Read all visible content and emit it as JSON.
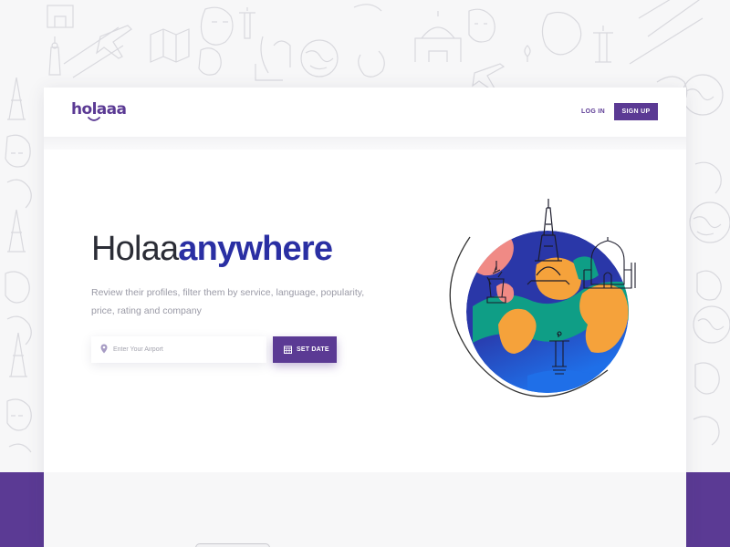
{
  "brand": {
    "logo_text": "holaaa",
    "primary_color": "#5b3a94",
    "accent_color": "#2a2fa3"
  },
  "nav": {
    "login_label": "LOG IN",
    "signup_label": "SIGN UP"
  },
  "hero": {
    "title_part1": "Holaa",
    "title_part2": "anywhere",
    "description": "Review their profiles, filter them by service, language, popularity, price, rating and company"
  },
  "search": {
    "placeholder": "Enter Your Airport",
    "value": "",
    "pin_icon": "location-pin-icon"
  },
  "set_date": {
    "label": "SET DATE",
    "icon": "calendar-icon"
  },
  "illustration": {
    "name": "globe-with-landmarks",
    "landmarks": [
      "statue-of-liberty",
      "eiffel-tower",
      "taj-mahal",
      "christ-the-redeemer"
    ],
    "colors": {
      "ocean": "#2a37a8",
      "ocean_light": "#1f6fe8",
      "land_orange": "#f5a23b",
      "land_green": "#0f9e86",
      "land_pink": "#f08a85"
    }
  },
  "background": {
    "pattern": "travel-doodles",
    "band_color": "#5b3a94"
  }
}
